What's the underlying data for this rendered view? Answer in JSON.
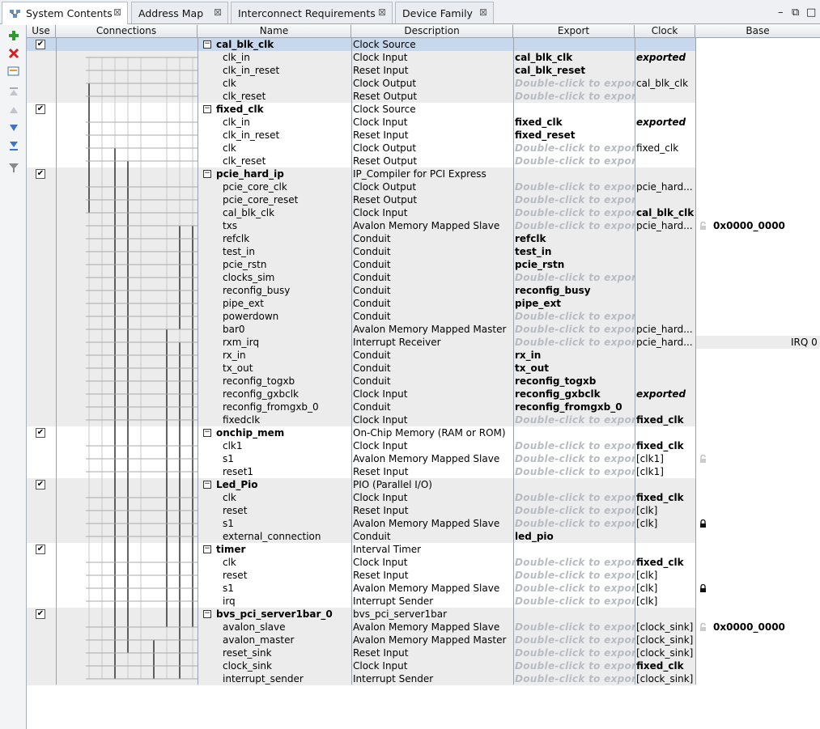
{
  "tabs": [
    {
      "label": "System Contents",
      "active": true
    },
    {
      "label": "Address Map",
      "active": false
    },
    {
      "label": "Interconnect Requirements",
      "active": false
    },
    {
      "label": "Device Family",
      "active": false
    }
  ],
  "window_controls": {
    "minimize": "–",
    "restore": "⧉",
    "maximize": "□"
  },
  "toolbar": [
    "add-icon",
    "remove-icon",
    "edit-icon",
    "move-top-icon",
    "move-up-icon",
    "move-down-icon",
    "move-bottom-icon",
    "filter-icon"
  ],
  "columns": {
    "use": "Use",
    "connections": "Connections",
    "name": "Name",
    "description": "Description",
    "export": "Export",
    "clock": "Clock",
    "base": "Base"
  },
  "expand_glyph": "−",
  "check_glyph": "✔",
  "irq_label": "IRQ 0",
  "rows": [
    {
      "type": "comp",
      "name": "cal_blk_clk",
      "desc": "Clock Source",
      "export": "",
      "clock": "",
      "base": "",
      "sel": true
    },
    {
      "type": "port",
      "name": "clk_in",
      "desc": "Clock Input",
      "export": "cal_blk_clk",
      "clock": "exported",
      "clockStyle": "i"
    },
    {
      "type": "port",
      "name": "clk_in_reset",
      "desc": "Reset Input",
      "export": "cal_blk_reset",
      "clock": ""
    },
    {
      "type": "port",
      "name": "clk",
      "desc": "Clock Output",
      "export": "Double-click to export",
      "hint": true,
      "clock": "cal_blk_clk"
    },
    {
      "type": "port",
      "name": "clk_reset",
      "desc": "Reset Output",
      "export": "Double-click to export",
      "hint": true,
      "clock": ""
    },
    {
      "type": "comp",
      "name": "fixed_clk",
      "desc": "Clock Source",
      "export": "",
      "clock": ""
    },
    {
      "type": "port",
      "name": "clk_in",
      "desc": "Clock Input",
      "export": "fixed_clk",
      "clock": "exported",
      "clockStyle": "i"
    },
    {
      "type": "port",
      "name": "clk_in_reset",
      "desc": "Reset Input",
      "export": "fixed_reset",
      "clock": ""
    },
    {
      "type": "port",
      "name": "clk",
      "desc": "Clock Output",
      "export": "Double-click to export",
      "hint": true,
      "clock": "fixed_clk"
    },
    {
      "type": "port",
      "name": "clk_reset",
      "desc": "Reset Output",
      "export": "Double-click to export",
      "hint": true,
      "clock": ""
    },
    {
      "type": "comp",
      "name": "pcie_hard_ip",
      "desc": "IP_Compiler for PCI Express",
      "export": "",
      "clock": ""
    },
    {
      "type": "port",
      "name": "pcie_core_clk",
      "desc": "Clock Output",
      "export": "Double-click to export",
      "hint": true,
      "clock": "pcie_hard..."
    },
    {
      "type": "port",
      "name": "pcie_core_reset",
      "desc": "Reset Output",
      "export": "Double-click to export",
      "hint": true,
      "clock": ""
    },
    {
      "type": "port",
      "name": "cal_blk_clk",
      "desc": "Clock Input",
      "export": "Double-click to export",
      "hint": true,
      "clock": "cal_blk_clk",
      "clockStyle": "b"
    },
    {
      "type": "port",
      "name": "txs",
      "desc": "Avalon Memory Mapped Slave",
      "export": "Double-click to export",
      "hint": true,
      "clock": "pcie_hard...",
      "base": "0x0000_0000",
      "lock": "open"
    },
    {
      "type": "port",
      "name": "refclk",
      "desc": "Conduit",
      "export": "refclk",
      "clock": ""
    },
    {
      "type": "port",
      "name": "test_in",
      "desc": "Conduit",
      "export": "test_in",
      "clock": ""
    },
    {
      "type": "port",
      "name": "pcie_rstn",
      "desc": "Conduit",
      "export": "pcie_rstn",
      "clock": ""
    },
    {
      "type": "port",
      "name": "clocks_sim",
      "desc": "Conduit",
      "export": "Double-click to export",
      "hint": true,
      "clock": ""
    },
    {
      "type": "port",
      "name": "reconfig_busy",
      "desc": "Conduit",
      "export": "reconfig_busy",
      "clock": ""
    },
    {
      "type": "port",
      "name": "pipe_ext",
      "desc": "Conduit",
      "export": "pipe_ext",
      "clock": ""
    },
    {
      "type": "port",
      "name": "powerdown",
      "desc": "Conduit",
      "export": "Double-click to export",
      "hint": true,
      "clock": ""
    },
    {
      "type": "port",
      "name": "bar0",
      "desc": "Avalon Memory Mapped Master",
      "export": "Double-click to export",
      "hint": true,
      "clock": "pcie_hard..."
    },
    {
      "type": "port",
      "name": "rxm_irq",
      "desc": "Interrupt Receiver",
      "export": "Double-click to export",
      "hint": true,
      "clock": "pcie_hard...",
      "irq": true
    },
    {
      "type": "port",
      "name": "rx_in",
      "desc": "Conduit",
      "export": "rx_in",
      "clock": ""
    },
    {
      "type": "port",
      "name": "tx_out",
      "desc": "Conduit",
      "export": "tx_out",
      "clock": ""
    },
    {
      "type": "port",
      "name": "reconfig_togxb",
      "desc": "Conduit",
      "export": "reconfig_togxb",
      "clock": ""
    },
    {
      "type": "port",
      "name": "reconfig_gxbclk",
      "desc": "Clock Input",
      "export": "reconfig_gxbclk",
      "clock": "exported",
      "clockStyle": "i"
    },
    {
      "type": "port",
      "name": "reconfig_fromgxb_0",
      "desc": "Conduit",
      "export": "reconfig_fromgxb_0",
      "clock": ""
    },
    {
      "type": "port",
      "name": "fixedclk",
      "desc": "Clock Input",
      "export": "Double-click to export",
      "hint": true,
      "clock": "fixed_clk",
      "clockStyle": "b"
    },
    {
      "type": "comp",
      "name": "onchip_mem",
      "desc": "On-Chip Memory (RAM or ROM)",
      "export": "",
      "clock": ""
    },
    {
      "type": "port",
      "name": "clk1",
      "desc": "Clock Input",
      "export": "Double-click to export",
      "hint": true,
      "clock": "fixed_clk",
      "clockStyle": "b"
    },
    {
      "type": "port",
      "name": "s1",
      "desc": "Avalon Memory Mapped Slave",
      "export": "Double-click to export",
      "hint": true,
      "clock": "[clk1]",
      "lock": "open"
    },
    {
      "type": "port",
      "name": "reset1",
      "desc": "Reset Input",
      "export": "Double-click to export",
      "hint": true,
      "clock": "[clk1]"
    },
    {
      "type": "comp",
      "name": "Led_Pio",
      "desc": "PIO (Parallel I/O)",
      "export": "",
      "clock": ""
    },
    {
      "type": "port",
      "name": "clk",
      "desc": "Clock Input",
      "export": "Double-click to export",
      "hint": true,
      "clock": "fixed_clk",
      "clockStyle": "b"
    },
    {
      "type": "port",
      "name": "reset",
      "desc": "Reset Input",
      "export": "Double-click to export",
      "hint": true,
      "clock": "[clk]"
    },
    {
      "type": "port",
      "name": "s1",
      "desc": "Avalon Memory Mapped Slave",
      "export": "Double-click to export",
      "hint": true,
      "clock": "[clk]",
      "lock": "closed"
    },
    {
      "type": "port",
      "name": "external_connection",
      "desc": "Conduit",
      "export": "led_pio",
      "clock": ""
    },
    {
      "type": "comp",
      "name": "timer",
      "desc": "Interval Timer",
      "export": "",
      "clock": ""
    },
    {
      "type": "port",
      "name": "clk",
      "desc": "Clock Input",
      "export": "Double-click to export",
      "hint": true,
      "clock": "fixed_clk",
      "clockStyle": "b"
    },
    {
      "type": "port",
      "name": "reset",
      "desc": "Reset Input",
      "export": "Double-click to export",
      "hint": true,
      "clock": "[clk]"
    },
    {
      "type": "port",
      "name": "s1",
      "desc": "Avalon Memory Mapped Slave",
      "export": "Double-click to export",
      "hint": true,
      "clock": "[clk]",
      "lock": "closed"
    },
    {
      "type": "port",
      "name": "irq",
      "desc": "Interrupt Sender",
      "export": "Double-click to export",
      "hint": true,
      "clock": "[clk]"
    },
    {
      "type": "comp",
      "name": "bvs_pci_server1bar_0",
      "desc": "bvs_pci_server1bar",
      "export": "",
      "clock": ""
    },
    {
      "type": "port",
      "name": "avalon_slave",
      "desc": "Avalon Memory Mapped Slave",
      "export": "Double-click to export",
      "hint": true,
      "clock": "[clock_sink]",
      "base": "0x0000_0000",
      "lock": "open"
    },
    {
      "type": "port",
      "name": "avalon_master",
      "desc": "Avalon Memory Mapped Master",
      "export": "Double-click to export",
      "hint": true,
      "clock": "[clock_sink]"
    },
    {
      "type": "port",
      "name": "reset_sink",
      "desc": "Reset Input",
      "export": "Double-click to export",
      "hint": true,
      "clock": "[clock_sink]"
    },
    {
      "type": "port",
      "name": "clock_sink",
      "desc": "Clock Input",
      "export": "Double-click to export",
      "hint": true,
      "clock": "fixed_clk",
      "clockStyle": "b"
    },
    {
      "type": "port",
      "name": "interrupt_sender",
      "desc": "Interrupt Sender",
      "export": "Double-click to export",
      "hint": true,
      "clock": "[clock_sink]"
    }
  ]
}
